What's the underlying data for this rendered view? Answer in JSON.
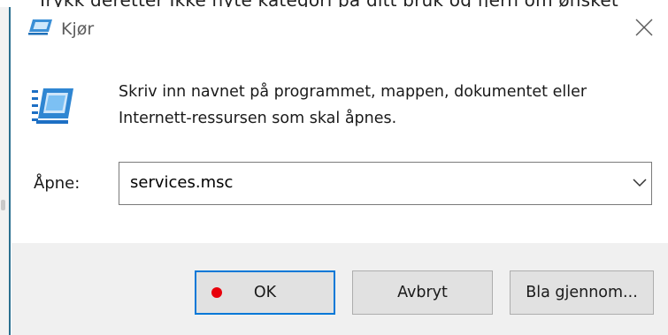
{
  "background_doc": {
    "cropped_text": "Trykk deretter Ikke nyte kategori på ditt bruk og fjern om ønsket"
  },
  "window": {
    "title": "Kjør",
    "icon": "run-icon",
    "close_icon": "close-icon"
  },
  "content": {
    "description": "Skriv inn navnet på programmet, mappen, dokumentet eller Internett-ressursen som skal åpnes.",
    "open_label": "Åpne:",
    "input_value": "services.msc",
    "dropdown_icon": "chevron-down-icon"
  },
  "buttons": {
    "ok": "OK",
    "cancel": "Avbryt",
    "browse": "Bla gjennom..."
  },
  "colors": {
    "accent": "#0078d7",
    "marker": "#e8000b",
    "doc_edge": "#2a6f8f"
  }
}
